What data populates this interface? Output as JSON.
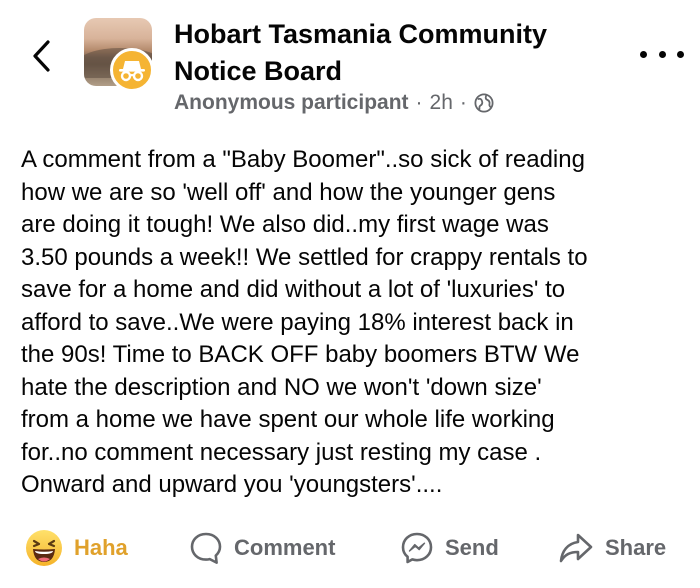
{
  "header": {
    "group_name_line1": "Hobart Tasmania Community",
    "group_name_line2": "Notice Board",
    "author": "Anonymous participant",
    "separator": "·",
    "time": "2h"
  },
  "post": {
    "lines": [
      "A comment from a \"Baby Boomer\"..so sick of reading",
      "how we are so 'well off' and how the younger gens",
      "are doing it tough!  We also did..my first wage was",
      "3.50 pounds a week!! We settled for crappy rentals to",
      "save for a home and did without a lot of 'luxuries' to",
      "afford to save..We were paying 18% interest back in",
      "the 90s!  Time to BACK OFF baby boomers BTW We",
      "hate the description and NO we won't 'down size'",
      "from a home we have spent our whole life working",
      "for..no comment necessary just resting my case .",
      "Onward and upward you 'youngsters'...."
    ]
  },
  "actions": {
    "haha": "Haha",
    "comment": "Comment",
    "send": "Send",
    "share": "Share"
  },
  "colors": {
    "reaction_active": "#e0a12b",
    "secondary_text": "#65676b",
    "anon_badge": "#f5b433"
  },
  "icons": {
    "back": "chevron-left-icon",
    "more": "more-dots-icon",
    "audience": "globe-icon",
    "anonymous": "incognito-icon",
    "haha": "haha-emoji-icon",
    "comment": "comment-bubble-icon",
    "send": "messenger-icon",
    "share": "share-arrow-icon"
  }
}
